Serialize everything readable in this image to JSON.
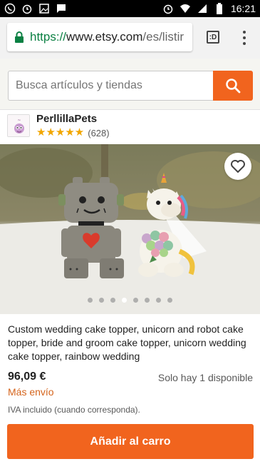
{
  "status_bar": {
    "time": "16:21",
    "left_icons": [
      "whatsapp-icon",
      "alarm-icon",
      "image-icon",
      "message-icon"
    ],
    "right_icons": [
      "alarm-icon",
      "wifi-icon",
      "signal-icon",
      "battery-icon"
    ]
  },
  "browser": {
    "url_scheme": "https://",
    "url_host": "www.etsy.com",
    "url_rest": "/es/listir",
    "tabs_label": ":D"
  },
  "search": {
    "placeholder": "Busca artículos y tiendas"
  },
  "shop": {
    "name": "PerllillaPets",
    "rating": 5,
    "stars": "★★★★★",
    "review_count": "(628)"
  },
  "gallery": {
    "image_count": 8,
    "active_index": 3
  },
  "listing": {
    "title": "Custom wedding cake topper, unicorn and robot cake topper, bride and groom cake topper, unicorn wedding cake topper, rainbow wedding",
    "price": "96,09 €",
    "stock": "Solo hay 1 disponible",
    "shipping": "Más envío",
    "vat": "IVA incluido (cuando corresponda).",
    "add_to_cart": "Añadir al carro"
  },
  "colors": {
    "accent": "#f1641e",
    "shipping_text": "#d5641c",
    "star": "#f1a600",
    "url_scheme": "#0b8043"
  }
}
